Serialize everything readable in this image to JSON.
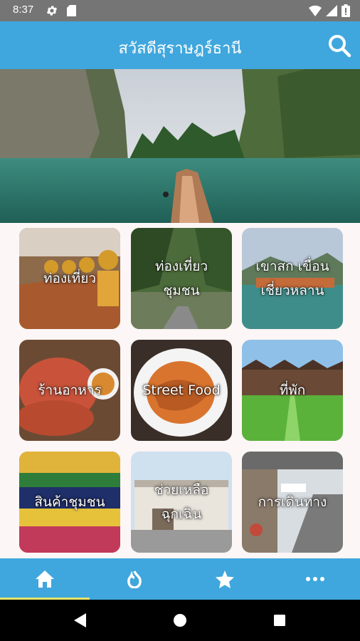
{
  "status_bar": {
    "time": "8:37"
  },
  "app_bar": {
    "title": "สวัสดีสุราษฎร์ธานี"
  },
  "categories": [
    {
      "label": "ท่องเที่ยว"
    },
    {
      "label": "ท่องเที่ยว\nชุมชน"
    },
    {
      "label": "เขาสก เขื่อน\nเชี่ยวหลาน"
    },
    {
      "label": "ร้านอาหาร"
    },
    {
      "label": "Street Food"
    },
    {
      "label": "ที่พัก"
    },
    {
      "label": "สินค้าชุมชน"
    },
    {
      "label": "ช่วยเหลือ\nฉุกเฉิน"
    },
    {
      "label": "การเดินทาง"
    }
  ],
  "bottom_nav": {
    "items": [
      {
        "icon": "home-icon"
      },
      {
        "icon": "flame-icon"
      },
      {
        "icon": "star-icon"
      },
      {
        "icon": "more-icon"
      }
    ],
    "active_index": 0
  },
  "colors": {
    "primary": "#3fa7dd",
    "status_bar": "#757575",
    "active_indicator": "#e8e36a"
  }
}
